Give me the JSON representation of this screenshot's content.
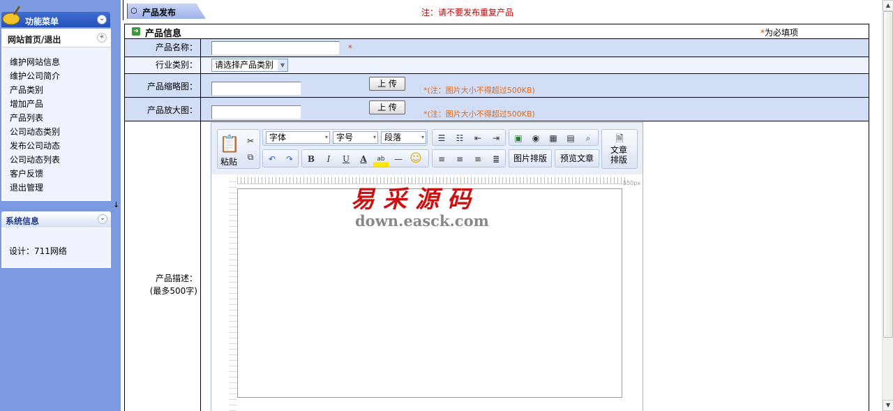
{
  "sidebar": {
    "menu_title": "功能菜单",
    "home_exit": "网站首页/退出",
    "items": [
      "维护网站信息",
      "维护公司简介",
      "产品类别",
      "增加产品",
      "产品列表",
      "公司动态类别",
      "发布公司动态",
      "公司动态列表",
      "客户反馈",
      "退出管理"
    ],
    "sys_title": "系统信息",
    "sys_text": "设计：711网络"
  },
  "header": {
    "tab_label": "产品发布",
    "note": "注：请不要发布重复产品"
  },
  "form": {
    "section_title": "产品信息",
    "required_star": "*",
    "required_note": "为必填项",
    "name_label": "产品名称：",
    "category_label": "行业类别：",
    "category_selected": "请选择产品类别",
    "thumb_label": "产品缩略图：",
    "big_label": "产品放大图：",
    "upload_label": "上 传",
    "upload_tip": "*(注：图片大小不得超过500KB)",
    "desc_label": "产品描述：",
    "desc_sub": "(最多500字)"
  },
  "editor": {
    "paste": "粘贴",
    "font": "字体",
    "size": "字号",
    "paragraph": "段落",
    "image_layout": "图片排版",
    "preview": "预览文章",
    "article_layout_1": "文章",
    "article_layout_2": "排版",
    "ruler": "550px",
    "watermark_cn": "易采源码",
    "watermark_en": "down.easck.com"
  }
}
